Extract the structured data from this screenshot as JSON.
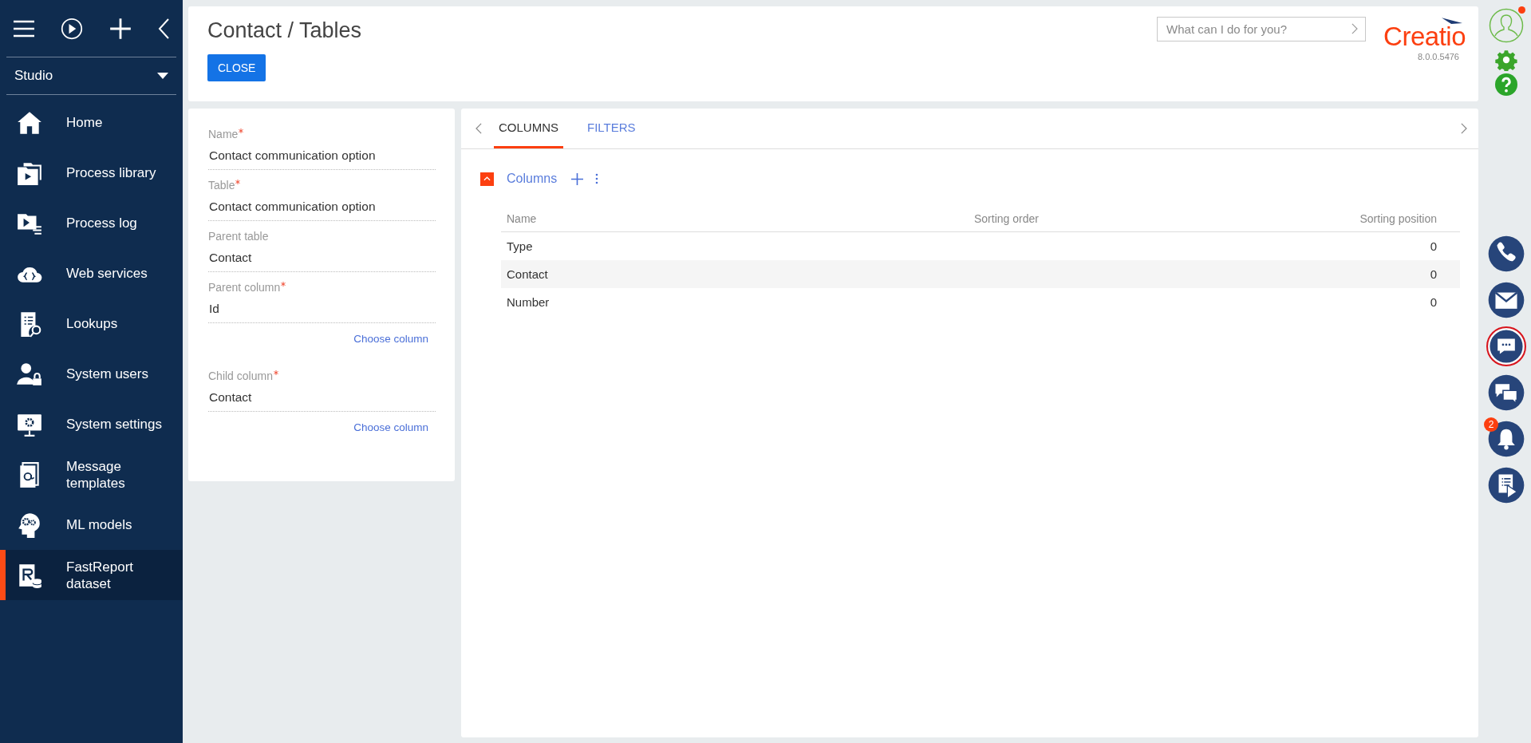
{
  "sidebar": {
    "workspace": "Studio",
    "items": [
      {
        "label": "Home",
        "kind": "home",
        "selected": false
      },
      {
        "label": "Process library",
        "kind": "library",
        "selected": false
      },
      {
        "label": "Process log",
        "kind": "log",
        "selected": false
      },
      {
        "label": "Web services",
        "kind": "cloud",
        "selected": false
      },
      {
        "label": "Lookups",
        "kind": "lookup",
        "selected": false
      },
      {
        "label": "System users",
        "kind": "user",
        "selected": false
      },
      {
        "label": "System settings",
        "kind": "monitor",
        "selected": false
      },
      {
        "label": "Message templates",
        "kind": "mail",
        "selected": false
      },
      {
        "label": "ML models",
        "kind": "head",
        "selected": false
      },
      {
        "label": "FastReport dataset",
        "kind": "report",
        "selected": true
      }
    ]
  },
  "header": {
    "title": "Contact / Tables",
    "close_button": "CLOSE",
    "search": {
      "placeholder": "What can I do for you?"
    },
    "logo": "Creatio",
    "version": "8.0.0.5476"
  },
  "form": {
    "fields": [
      {
        "label": "Name",
        "required": true,
        "value": "Contact communication option"
      },
      {
        "label": "Table",
        "required": true,
        "value": "Contact communication option"
      },
      {
        "label": "Parent table",
        "required": false,
        "value": "Contact"
      },
      {
        "label": "Parent column",
        "required": true,
        "value": "Id",
        "link": "Choose column"
      },
      {
        "label": "Child column",
        "required": true,
        "value": "Contact",
        "link": "Choose column"
      }
    ]
  },
  "tabs": [
    {
      "label": "COLUMNS",
      "selected": true
    },
    {
      "label": "FILTERS",
      "selected": false
    }
  ],
  "detail": {
    "title": "Columns",
    "expanded": true,
    "table": {
      "columns": [
        "Name",
        "Sorting order",
        "Sorting position"
      ],
      "rows": [
        {
          "cells": [
            "Type",
            "",
            "0"
          ],
          "selected": false
        },
        {
          "cells": [
            "Contact",
            "",
            "0"
          ],
          "selected": true
        },
        {
          "cells": [
            "Number",
            "",
            "0"
          ],
          "selected": false
        }
      ]
    }
  },
  "right_bar": {
    "avatar_notification": true,
    "buttons": [
      {
        "kind": "phone",
        "selected": false
      },
      {
        "kind": "email",
        "selected": false
      },
      {
        "kind": "chat",
        "selected": true
      },
      {
        "kind": "feed",
        "selected": false
      },
      {
        "kind": "notifications",
        "selected": false,
        "badge": "2"
      },
      {
        "kind": "process",
        "selected": false
      }
    ]
  }
}
